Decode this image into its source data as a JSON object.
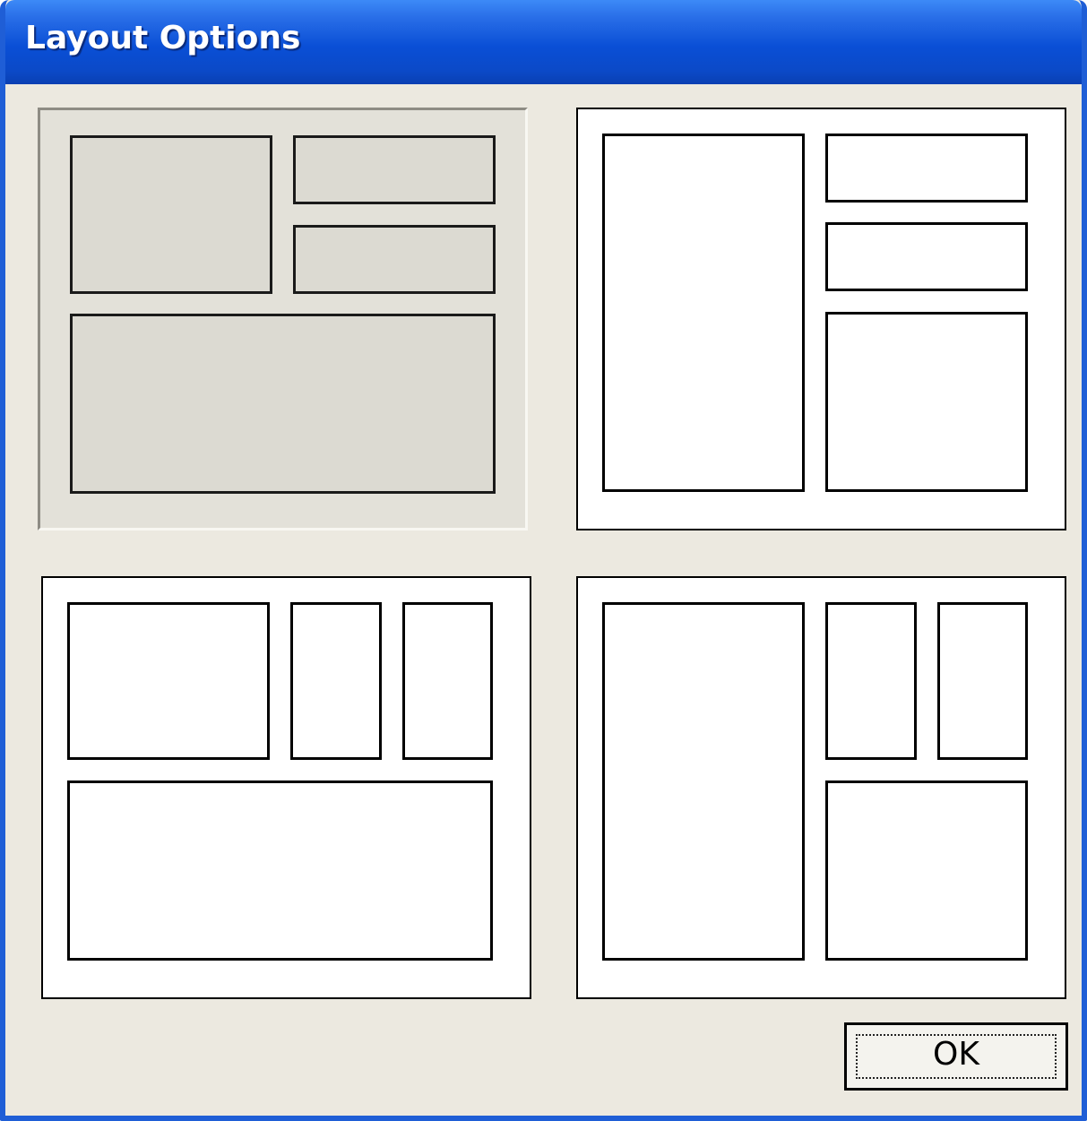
{
  "window": {
    "title": "Layout Options"
  },
  "layout_options": [
    {
      "name": "layout-option-1",
      "selected": true
    },
    {
      "name": "layout-option-2",
      "selected": false
    },
    {
      "name": "layout-option-3",
      "selected": false
    },
    {
      "name": "layout-option-4",
      "selected": false
    }
  ],
  "buttons": {
    "ok_label": "OK"
  },
  "colors": {
    "titlebar": "#0a4fd6",
    "window_border": "#1f5ed6",
    "dialog_face": "#ece9e0"
  }
}
